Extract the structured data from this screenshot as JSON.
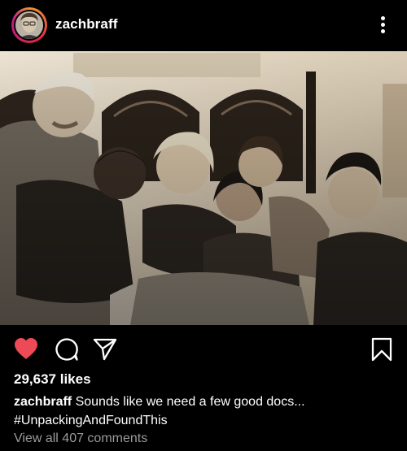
{
  "post": {
    "username": "zachbraff",
    "likes": "29,637 likes",
    "caption_user": "zachbraff",
    "caption_text": "Sounds like we need a few good docs...",
    "hashtag": "#UnpackingAndFoundThis",
    "view_comments": "View all 407 comments",
    "liked": true
  },
  "icons": {
    "more": "more-vertical-icon",
    "like": "heart-filled-icon",
    "comment": "comment-icon",
    "share": "send-icon",
    "save": "bookmark-icon"
  },
  "colors": {
    "background": "#000000",
    "text": "#ffffff",
    "muted": "#9b9b9b",
    "like_red": "#ed4956"
  }
}
